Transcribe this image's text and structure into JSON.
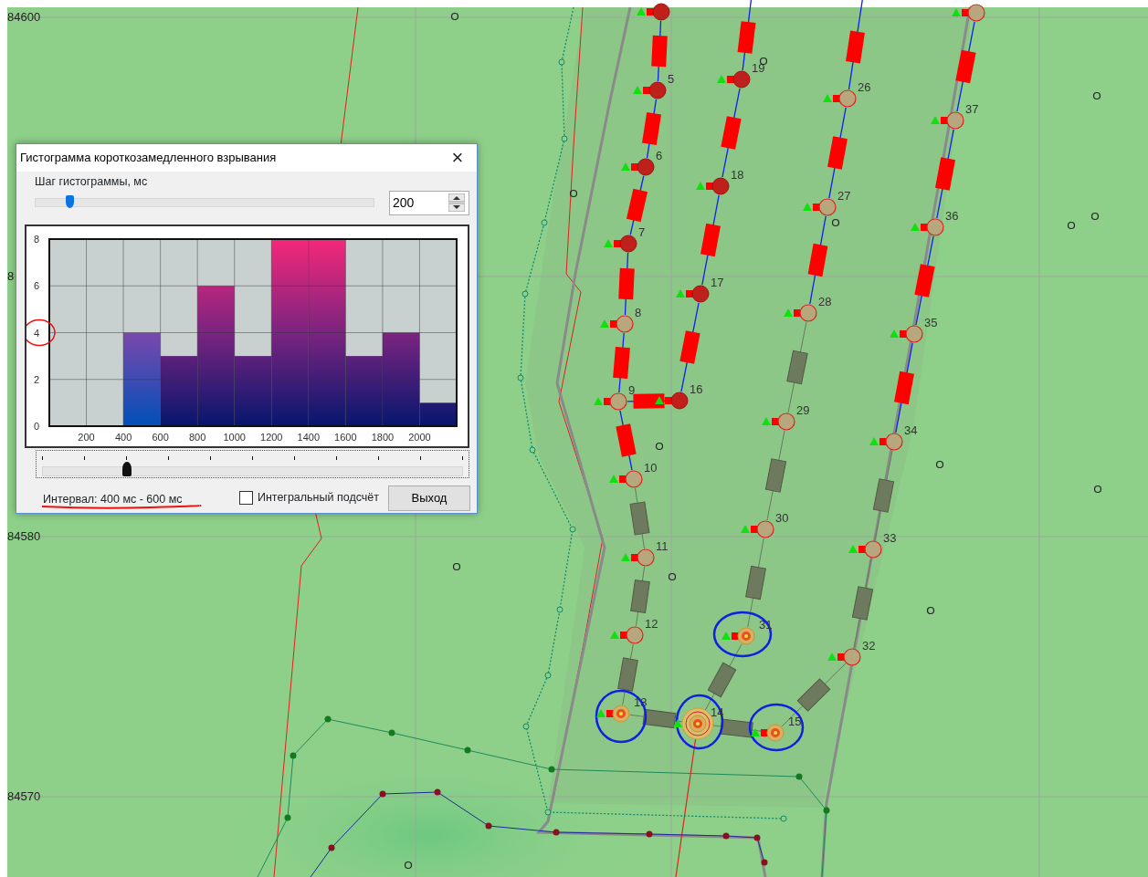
{
  "map": {
    "coordinate_labels": [
      {
        "text": "84600"
      },
      {
        "text": "8"
      },
      {
        "text": "84580"
      },
      {
        "text": "84570"
      }
    ],
    "holes": [
      {
        "kind": "charged"
      },
      {
        "kind": "plain"
      },
      {
        "label": "5",
        "kind": "charged"
      },
      {
        "label": "6",
        "kind": "charged"
      },
      {
        "label": "7",
        "kind": "charged"
      },
      {
        "label": "8",
        "kind": "plain"
      },
      {
        "label": "9",
        "kind": "plain"
      },
      {
        "label": "10",
        "kind": "plain"
      },
      {
        "label": "11",
        "kind": "plain"
      },
      {
        "label": "12",
        "kind": "plain"
      },
      {
        "label": "13",
        "kind": "burst"
      },
      {
        "label": "14",
        "kind": "burst"
      },
      {
        "label": "15",
        "kind": "burst"
      },
      {
        "label": "16",
        "kind": "charged"
      },
      {
        "label": "17",
        "kind": "charged"
      },
      {
        "label": "18",
        "kind": "charged"
      },
      {
        "label": "19",
        "kind": "charged"
      },
      {
        "label": "26",
        "kind": "plain"
      },
      {
        "label": "27",
        "kind": "plain"
      },
      {
        "label": "28",
        "kind": "plain"
      },
      {
        "label": "29",
        "kind": "plain"
      },
      {
        "label": "30",
        "kind": "plain"
      },
      {
        "label": "31",
        "kind": "burst"
      },
      {
        "label": "32",
        "kind": "plain"
      },
      {
        "label": "33",
        "kind": "plain"
      },
      {
        "label": "34",
        "kind": "plain"
      },
      {
        "label": "35",
        "kind": "plain"
      },
      {
        "label": "36",
        "kind": "plain"
      },
      {
        "label": "37",
        "kind": "plain"
      }
    ]
  },
  "dialog": {
    "title": "Гистограмма короткозамедленного взрывания",
    "close": "×",
    "step_label": "Шаг гистограммы, мс",
    "histogram_step": {
      "level": 0.1
    },
    "step_value": "200",
    "chart_data": {
      "type": "bar",
      "x": [
        100,
        300,
        500,
        700,
        900,
        1100,
        1300,
        1500,
        1700,
        1900,
        2100
      ],
      "values": [
        0,
        0,
        4,
        3,
        6,
        3,
        8,
        8,
        3,
        4,
        1
      ],
      "xticks": [
        200,
        400,
        600,
        800,
        1000,
        1200,
        1400,
        1600,
        1800,
        2000
      ],
      "yticks": [
        0,
        2,
        4,
        6,
        8
      ],
      "xlim": [
        0,
        2200
      ],
      "ylim": [
        0,
        8
      ],
      "grid": true
    },
    "interval_slider": {
      "level": 0.2
    },
    "interval_text": "Интервал:  400 мс - 600 мс",
    "integral": {
      "label": "Интегральный подсчёт",
      "checked": false
    },
    "exit_button": "Выход"
  }
}
